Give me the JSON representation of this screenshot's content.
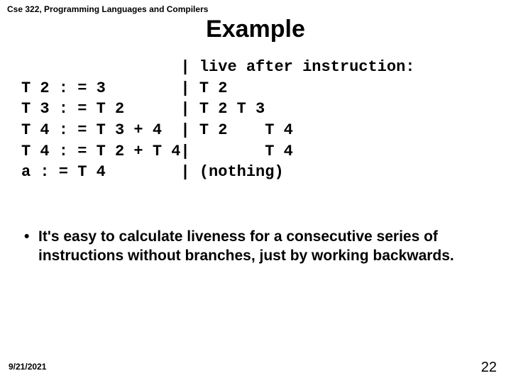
{
  "course_header": "Cse 322, Programming Languages and Compilers",
  "title": "Example",
  "code": {
    "lines": [
      "                 | live after instruction:",
      "T 2 : = 3        | T 2",
      "T 3 : = T 2      | T 2 T 3",
      "T 4 : = T 3 + 4  | T 2    T 4",
      "T 4 : = T 2 + T 4|        T 4",
      "a : = T 4        | (nothing)"
    ]
  },
  "bullets": [
    "It's easy to calculate liveness for a consecutive series of instructions without branches, just by working backwards."
  ],
  "footer": {
    "date": "9/21/2021",
    "page": "22"
  }
}
